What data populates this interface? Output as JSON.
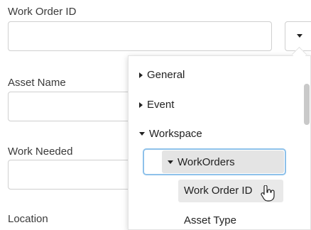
{
  "form": {
    "fields": [
      {
        "label": "Work Order ID",
        "value": ""
      },
      {
        "label": "Asset Name",
        "value": ""
      },
      {
        "label": "Work Needed",
        "value": ""
      },
      {
        "label": "Location",
        "value": ""
      }
    ]
  },
  "tree": {
    "items": [
      {
        "label": "General",
        "state": "collapsed"
      },
      {
        "label": "Event",
        "state": "collapsed"
      },
      {
        "label": "Workspace",
        "state": "expanded"
      },
      {
        "label": "WorkOrders",
        "state": "expanded"
      },
      {
        "label": "Work Order ID",
        "state": "leaf-hover"
      },
      {
        "label": "Asset Type",
        "state": "leaf"
      }
    ]
  },
  "icons": {
    "dropdown": "chevron-down-icon",
    "cursor": "hand-pointer-icon"
  },
  "colors": {
    "focus_border": "#8ec1ea",
    "selected_bg": "#e4e4e4"
  }
}
